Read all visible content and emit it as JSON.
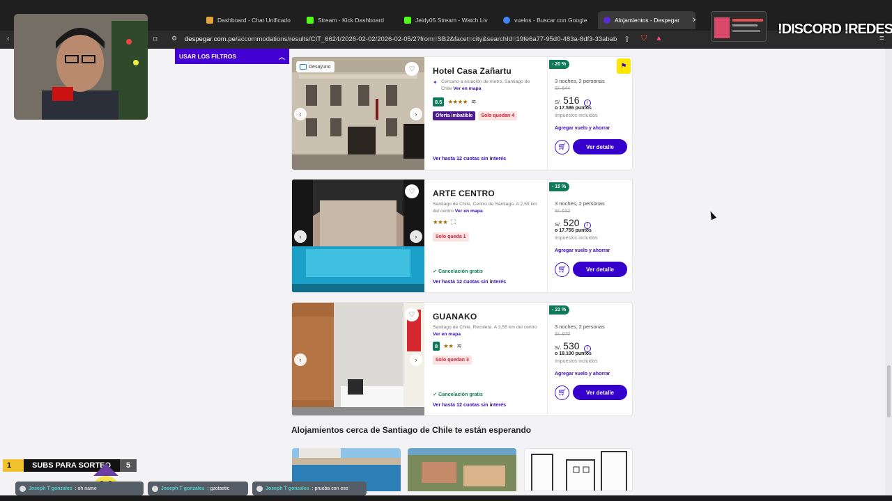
{
  "browser": {
    "tabs": [
      {
        "title": "Dashboard - Chat Unificado",
        "color": "#e6a23c"
      },
      {
        "title": "Stream - Kick Dashboard",
        "color": "#53fc18"
      },
      {
        "title": "Jeidy05 Stream - Watch Liv",
        "color": "#53fc18"
      },
      {
        "title": "vuelos - Buscar con Google",
        "color": "#4285f4"
      },
      {
        "title": "Alojamientos - Despegar",
        "color": "#5b2ad6"
      }
    ],
    "url_domain": "despegar.com.pe",
    "url_path": "/accommodations/results/CIT_6624/2026-02-02/2026-02-05/2?from=SB2&facet=city&searchId=19fe6a77-95d0-483a-8df3-33abab..."
  },
  "filters_button": "USAR LOS FILTROS",
  "hotels": [
    {
      "name": "Hotel Casa Zañartu",
      "location": "Cercano a estación de metro, Santiago de Chile",
      "map_link": "Ver en mapa",
      "score": "8.5",
      "stars": "★★★★",
      "photo_badge": "Desayuno",
      "tags": [
        "Oferta imbatible",
        "Solo quedan 4"
      ],
      "free_cancel": "",
      "installments": "Ver hasta 12 cuotas sin interés",
      "discount": "- 20 %",
      "stay": "3 noches, 2 personas",
      "old_price": "S/. 644",
      "currency": "S/.",
      "price": "516",
      "points": "o 17.586 puntos",
      "taxes": "Impuestos incluidos",
      "add_flight": "Agregar vuelo y ahorrar",
      "detail_button": "Ver detalle"
    },
    {
      "name": "ARTE CENTRO",
      "location": "Santiago de Chile, Centro de Santiago. A 2,59 km del centro",
      "map_link": "Ver en mapa",
      "score": "",
      "stars": "★★★",
      "photo_badge": "",
      "tags": [
        "Solo queda 1"
      ],
      "free_cancel": "✓ Cancelación gratis",
      "installments": "Ver hasta 12 cuotas sin interés",
      "discount": "- 15 %",
      "stay": "3 noches, 2 personas",
      "old_price": "S/. 612",
      "currency": "S/.",
      "price": "520",
      "points": "o 17.755 puntos",
      "taxes": "Impuestos incluidos",
      "add_flight": "Agregar vuelo y ahorrar",
      "detail_button": "Ver detalle"
    },
    {
      "name": "GUANAKO",
      "location": "Santiago de Chile, Recoleta. A 3,55 km del centro",
      "map_link": "Ver en mapa",
      "score": "8",
      "stars": "★★",
      "photo_badge": "",
      "tags": [
        "Solo quedan 3"
      ],
      "free_cancel": "✓ Cancelación gratis",
      "installments": "Ver hasta 12 cuotas sin interés",
      "discount": "- 21 %",
      "stay": "3 noches, 2 personas",
      "old_price": "S/. 670",
      "currency": "S/.",
      "price": "530",
      "points": "o 18.100 puntos",
      "taxes": "Impuestos incluidos",
      "add_flight": "Agregar vuelo y ahorrar",
      "detail_button": "Ver detalle"
    }
  ],
  "nearby_title": "Alojamientos cerca de Santiago de Chile te están esperando",
  "overlay": {
    "banner": "!DISCORD !REDES",
    "subs_current": "1",
    "subs_label": "SUBS PARA SORTEO",
    "subs_goal": "5",
    "chat": [
      {
        "user": "Joseph T gonzales",
        "msg": ": oh name"
      },
      {
        "user": "Joseph T gonzales",
        "msg": ": gzotastic"
      },
      {
        "user": "Joseph T gonzales",
        "msg": ": prueba con ese"
      }
    ]
  },
  "colors": {
    "brand": "#3500cc",
    "success": "#0f7a5a",
    "alert": "#c2263a"
  }
}
